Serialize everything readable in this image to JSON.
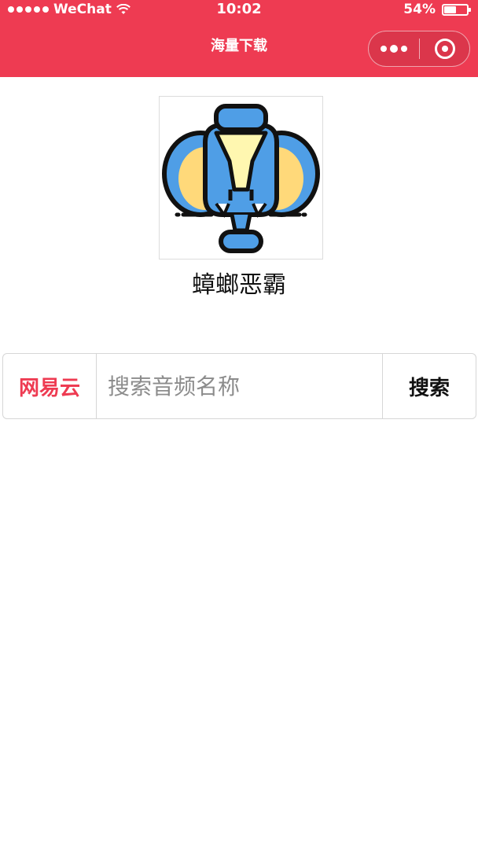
{
  "status_bar": {
    "carrier": "WeChat",
    "time": "10:02",
    "battery_text": "54%",
    "battery_level": 0.54
  },
  "nav": {
    "title": "海量下载",
    "more_icon": "more-dots-icon",
    "close_icon": "target-close-icon"
  },
  "profile": {
    "name": "蟑螂恶霸",
    "avatar_icon": "cockroach-mascot-icon"
  },
  "search": {
    "source_label": "网易云",
    "placeholder": "搜索音频名称",
    "value": "",
    "button_label": "搜索"
  },
  "colors": {
    "brand": "#ee3b52",
    "avatar_blue": "#4f9ee6",
    "avatar_yellow": "#ffd97a",
    "avatar_cream": "#fff7b0"
  }
}
